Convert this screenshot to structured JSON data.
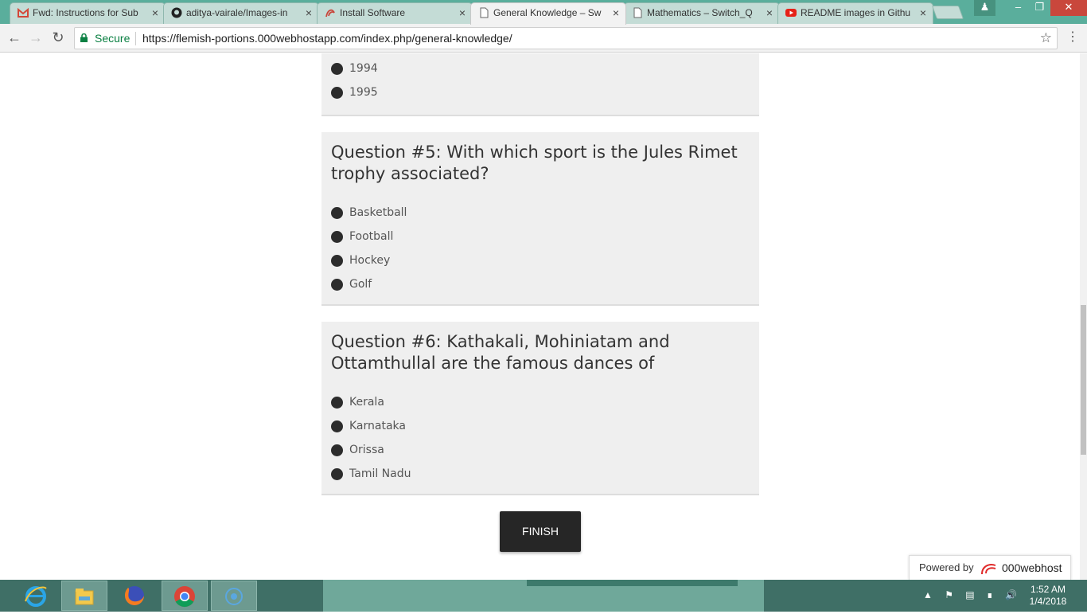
{
  "browser": {
    "tabs": [
      {
        "title": "Fwd: Instructions for Sub",
        "icon": "gmail-icon",
        "active": false
      },
      {
        "title": "aditya-vairale/Images-in",
        "icon": "github-icon",
        "active": false
      },
      {
        "title": "Install Software",
        "icon": "page-icon",
        "active": false
      },
      {
        "title": "General Knowledge – Sw",
        "icon": "page-icon",
        "active": true
      },
      {
        "title": "Mathematics – Switch_Q",
        "icon": "page-icon",
        "active": false
      },
      {
        "title": "README images in Githu",
        "icon": "youtube-icon",
        "active": false
      }
    ],
    "close_glyph": "×",
    "secure_label": "Secure",
    "url": "https://flemish-portions.000webhostapp.com/index.php/general-knowledge/"
  },
  "quiz": {
    "prev_options": [
      "1994",
      "1995"
    ],
    "questions": [
      {
        "title": "Question #5: With which sport is the Jules Rimet trophy associated?",
        "options": [
          "Basketball",
          "Football",
          "Hockey",
          "Golf"
        ]
      },
      {
        "title": "Question #6: Kathakali, Mohiniatam and Ottamthullal are the famous dances of",
        "options": [
          "Kerala",
          "Karnataka",
          "Orissa",
          "Tamil Nadu"
        ]
      }
    ],
    "finish_label": "FINISH"
  },
  "footer": {
    "powered_by": "Powered by",
    "brand": "000webhost"
  },
  "taskbar": {
    "apps": [
      "internet-explorer-icon",
      "file-explorer-icon",
      "firefox-icon",
      "chrome-icon",
      "cortana-icon"
    ],
    "time": "1:52 AM",
    "date": "1/4/2018"
  },
  "colors": {
    "tabstrip": "#5aae9c",
    "secure_green": "#0b8043",
    "card_bg": "#efefef",
    "finish_bg": "#262626",
    "taskbar": "#3f6f66"
  }
}
